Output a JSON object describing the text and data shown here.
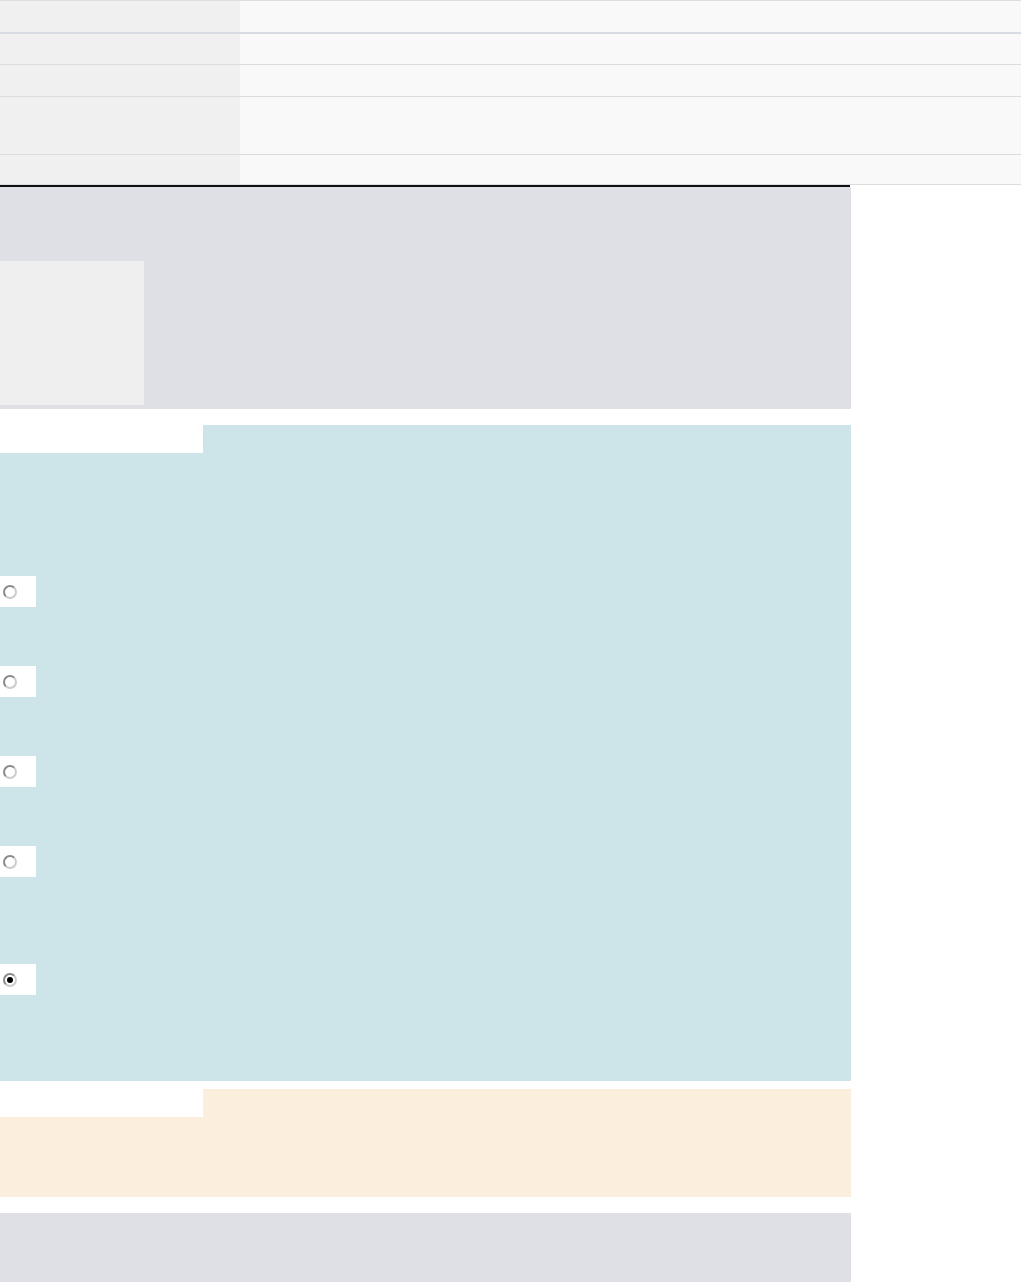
{
  "answers": [
    {
      "selected": false
    },
    {
      "selected": false
    },
    {
      "selected": false
    },
    {
      "selected": false
    },
    {
      "selected": true
    }
  ]
}
